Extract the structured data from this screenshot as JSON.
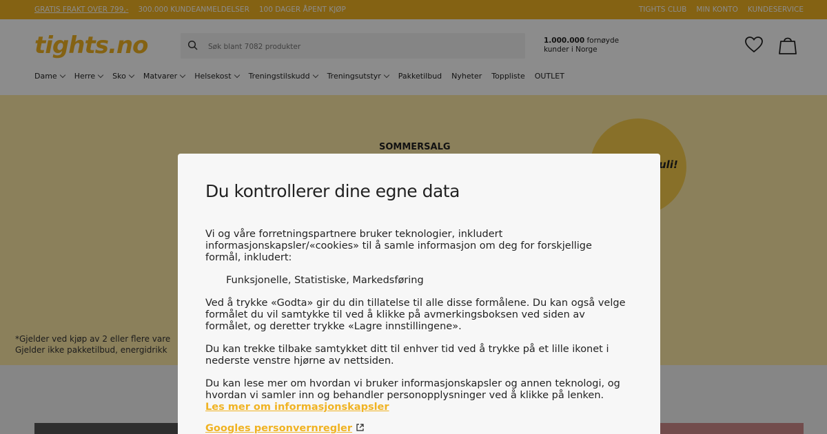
{
  "topbar": {
    "left": [
      "GRATIS FRAKT OVER 799,-",
      "300.000 KUNDEANMELDELSER",
      "100 DAGER ÅPENT KJØP"
    ],
    "right": [
      "TIGHTS CLUB",
      "MIN KONTO",
      "KUNDESERVICE"
    ]
  },
  "header": {
    "logo": "tights.no",
    "search_placeholder": "Søk blant 7082 produkter",
    "happy_bold": "1.000.000",
    "happy_rest": " fornøyde",
    "happy_line2": "kunder i Norge",
    "icons": [
      "search-icon",
      "heart-icon",
      "bag-icon"
    ]
  },
  "nav": [
    {
      "label": "Dame",
      "chevron": true
    },
    {
      "label": "Herre",
      "chevron": true
    },
    {
      "label": "Sko",
      "chevron": true
    },
    {
      "label": "Matvarer",
      "chevron": true
    },
    {
      "label": "Helsekost",
      "chevron": true
    },
    {
      "label": "Treningstilskudd",
      "chevron": true
    },
    {
      "label": "Treningsutstyr",
      "chevron": true
    },
    {
      "label": "Pakketilbud",
      "chevron": false
    },
    {
      "label": "Nyheter",
      "chevron": false
    },
    {
      "label": "Toppliste",
      "chevron": false
    },
    {
      "label": "OUTLET",
      "chevron": false
    }
  ],
  "hero": {
    "sale": "SOMMERSALG",
    "badge": "uli!",
    "note_line1": "*Gjelder ved kjøp av 2 eller flere vare",
    "note_line2": "Gjelder ikke pakketilbud, energidrikk"
  },
  "modal": {
    "title": "Du kontrollerer dine egne data",
    "p1": "Vi og våre forretningspartnere bruker teknologier, inkludert informasjonskapsler/«cookies» til å samle informasjon om deg for forskjellige formål, inkludert:",
    "purposes": "Funksjonelle, Statistiske, Markedsføring",
    "p2": "Ved å trykke «Godta» gir du din tillatelse til alle disse formålene. Du kan også velge formålet du vil samtykke til ved å klikke på avmerkingsboksen ved siden av formålet, og deretter trykke «Lagre innstillingene».",
    "p3": "Du kan trekke tilbake samtykket ditt til enhver tid ved å trykke på et lille ikonet i nederste venstre hjørne av nettsiden.",
    "p4": "Du kan lese mer om hvordan vi bruker informasjonskapsler og annen teknologi, og hvordan vi samler inn og behandler personopplysninger ved å klikke på lenken.",
    "link1": "Les mer om informasjonskapsler",
    "link2": "Googles personvernregler"
  },
  "colors": {
    "brand": "#f0b323",
    "hero": "#fde9a6"
  }
}
